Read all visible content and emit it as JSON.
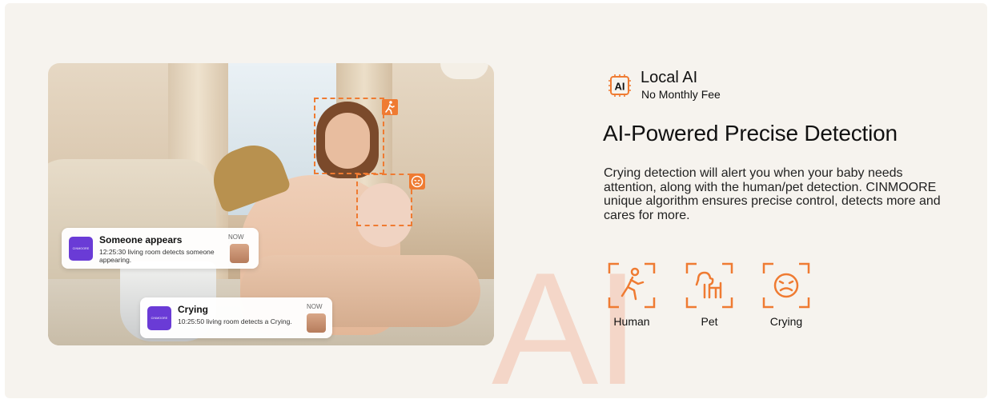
{
  "photo": {
    "notifications": [
      {
        "logo_text": "CINMOORE",
        "title": "Someone appears",
        "time_label": "NOW",
        "message": "12:25:30 living room detects someone appearing."
      },
      {
        "logo_text": "CINMOORE",
        "title": "Crying",
        "time_label": "NOW",
        "message": "10:25:50 living room detects a Crying."
      }
    ],
    "detection_tags": [
      "person-walking-icon",
      "crying-face-icon"
    ]
  },
  "watermark": "AI",
  "badge": {
    "icon_text": "AI",
    "title": "Local AI",
    "subtitle": "No Monthly Fee"
  },
  "headline": "AI-Powered Precise Detection",
  "description": "Crying detection will alert you when your baby needs attention, along with the human/pet detection. CINMOORE unique algorithm ensures precise control, detects more and cares for more.",
  "features": [
    {
      "label": "Human",
      "icon": "human-icon"
    },
    {
      "label": "Pet",
      "icon": "pet-icon"
    },
    {
      "label": "Crying",
      "icon": "crying-icon"
    }
  ],
  "accent_color": "#ef7b32"
}
